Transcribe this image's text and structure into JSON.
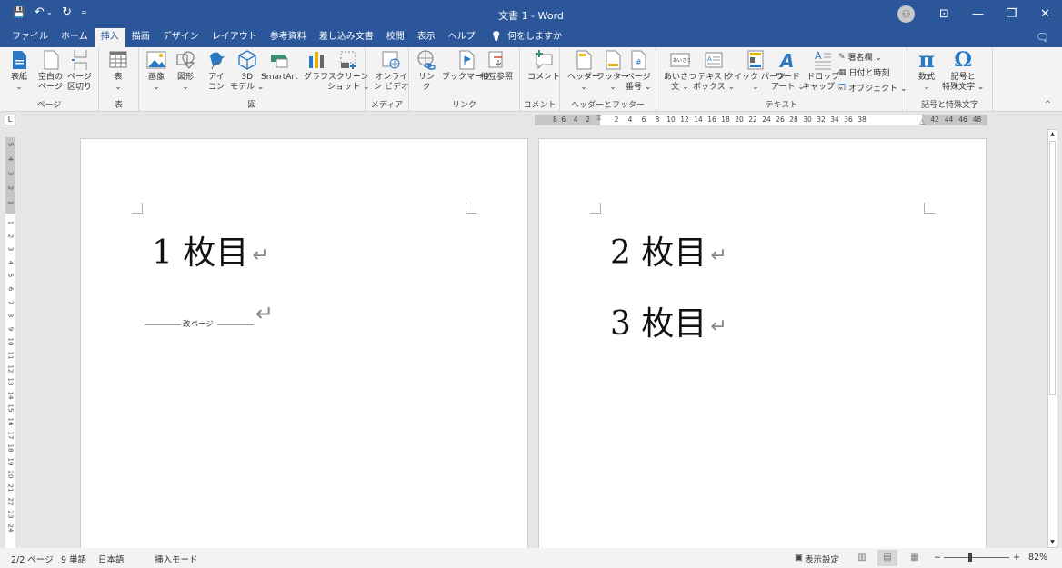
{
  "window": {
    "title": "文書 1  -  Word",
    "quick_access": {
      "save_icon": "💾",
      "undo_icon": "↶",
      "undo_dropdown": "⌄",
      "redo_icon": "↻",
      "customize": "="
    },
    "controls": {
      "account_icon": "👤",
      "ribbon_display": "⊡",
      "minimize": "—",
      "restore": "❐",
      "close": "✕"
    }
  },
  "tabs": [
    {
      "label": "ファイル"
    },
    {
      "label": "ホーム"
    },
    {
      "label": "挿入",
      "active": true
    },
    {
      "label": "描画"
    },
    {
      "label": "デザイン"
    },
    {
      "label": "レイアウト"
    },
    {
      "label": "参考資料"
    },
    {
      "label": "差し込み文書"
    },
    {
      "label": "校閲"
    },
    {
      "label": "表示"
    },
    {
      "label": "ヘルプ"
    }
  ],
  "tell_me": {
    "icon": "💡",
    "label": "何をしますか"
  },
  "comments_icon": "🗨",
  "ribbon": {
    "groups": {
      "page": {
        "label": "ページ",
        "buttons": [
          {
            "l1": "表紙",
            "l2": "⌄"
          },
          {
            "l1": "空白の",
            "l2": "ページ"
          },
          {
            "l1": "ページ",
            "l2": "区切り"
          }
        ]
      },
      "table": {
        "label": "表",
        "buttons": [
          {
            "l1": "表",
            "l2": "⌄"
          }
        ]
      },
      "illustrations": {
        "label": "図",
        "buttons": [
          {
            "l1": "画像",
            "l2": "⌄"
          },
          {
            "l1": "図形",
            "l2": "⌄"
          },
          {
            "l1": "アイ",
            "l2": "コン"
          },
          {
            "l1": "3D",
            "l2": "モデル ⌄"
          },
          {
            "l1": "SmartArt",
            "l2": ""
          },
          {
            "l1": "グラフ",
            "l2": ""
          },
          {
            "l1": "スクリーン",
            "l2": "ショット ⌄"
          }
        ]
      },
      "media": {
        "label": "メディア",
        "buttons": [
          {
            "l1": "オンライ",
            "l2": "ン ビデオ"
          }
        ]
      },
      "links": {
        "label": "リンク",
        "buttons": [
          {
            "l1": "リン",
            "l2": "ク"
          },
          {
            "l1": "ブックマーク",
            "l2": ""
          },
          {
            "l1": "相互参照",
            "l2": ""
          }
        ]
      },
      "comments": {
        "label": "コメント",
        "buttons": [
          {
            "l1": "コメント",
            "l2": ""
          }
        ]
      },
      "header_footer": {
        "label": "ヘッダーとフッター",
        "buttons": [
          {
            "l1": "ヘッダー",
            "l2": "⌄"
          },
          {
            "l1": "フッター",
            "l2": "⌄"
          },
          {
            "l1": "ページ",
            "l2": "番号 ⌄"
          }
        ]
      },
      "text": {
        "label": "テキスト",
        "buttons": [
          {
            "l1": "あいさつ",
            "l2": "文 ⌄"
          },
          {
            "l1": "テキスト",
            "l2": "ボックス ⌄"
          },
          {
            "l1": "クイック パーツ",
            "l2": "⌄"
          },
          {
            "l1": "ワード",
            "l2": "アート ⌄"
          },
          {
            "l1": "ドロップ",
            "l2": "キャップ ⌄"
          }
        ],
        "small": [
          {
            "label": "署名欄  ⌄"
          },
          {
            "label": "日付と時刻"
          },
          {
            "label": "オブジェクト  ⌄"
          }
        ]
      },
      "symbols": {
        "label": "記号と特殊文字",
        "buttons": [
          {
            "l1": "数式",
            "l2": "⌄"
          },
          {
            "l1": "記号と",
            "l2": "特殊文字 ⌄"
          }
        ]
      }
    },
    "collapse_icon": "^"
  },
  "ruler": {
    "tab_selector": "L",
    "horizontal_left": [
      "8",
      "6",
      "4",
      "2"
    ],
    "horizontal_main": [
      "2",
      "4",
      "6",
      "8",
      "10",
      "12",
      "14",
      "16",
      "18",
      "20",
      "22",
      "24",
      "26",
      "28",
      "30",
      "32",
      "34",
      "36",
      "38"
    ],
    "horizontal_right": [
      "42",
      "44",
      "46",
      "48"
    ],
    "vertical_top": [
      "5",
      "4",
      "3",
      "2",
      "1"
    ],
    "vertical_main": [
      "1",
      "2",
      "3",
      "4",
      "5",
      "6",
      "7",
      "8",
      "9",
      "10",
      "11",
      "12",
      "13",
      "14",
      "15",
      "16",
      "17",
      "18",
      "19",
      "20",
      "21",
      "22",
      "23",
      "24"
    ]
  },
  "document": {
    "page1": {
      "lines": [
        "1 枚目"
      ],
      "page_break_label": "改ページ",
      "return_mark": "↵"
    },
    "page2": {
      "lines": [
        "2 枚目",
        "3 枚目"
      ],
      "return_mark": "↵"
    }
  },
  "scrollbar": {
    "up": "▲",
    "down": "▼"
  },
  "status": {
    "page": "2/2 ページ",
    "words": "9 単語",
    "language": "日本語",
    "mode": "挿入モード",
    "display_settings": "表示設定",
    "zoom_minus": "−",
    "zoom_plus": "+",
    "zoom": "82%",
    "zoom_percent": 82
  }
}
